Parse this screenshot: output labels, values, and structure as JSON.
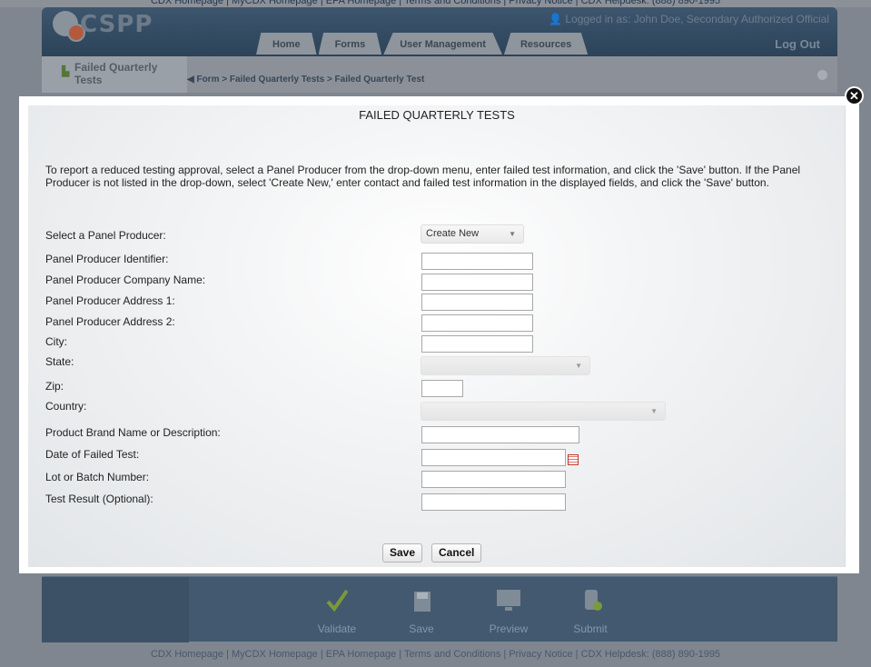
{
  "top_links": "CDX Homepage  |  MyCDX Homepage  |  EPA Homepage  |  Terms and Conditions  |  Privacy Notice  |  CDX Helpdesk: (888) 890-1995",
  "app": {
    "logo_text": "CSPP",
    "logged_in": "Logged in as: John Doe, Secondary Authorized Official",
    "logout": "Log Out",
    "tabs": [
      "Home",
      "Forms",
      "User Management",
      "Resources"
    ],
    "sub_title": "Failed Quarterly Tests",
    "breadcrumb": "Form > Failed Quarterly Tests > Failed Quarterly Test"
  },
  "modal": {
    "title": "FAILED QUARTERLY TESTS",
    "instructions": "To report a reduced testing approval, select a Panel Producer from the drop-down menu, enter failed test information, and click the 'Save' button. If the Panel Producer is not listed in the drop-down, select 'Create New,' enter contact and failed test information in the displayed fields, and click the 'Save' button.",
    "fields": {
      "panel_producer_select": {
        "label": "Select a Panel Producer:",
        "value": "Create New"
      },
      "producer_id": {
        "label": "Panel Producer Identifier:",
        "value": ""
      },
      "company_name": {
        "label": "Panel Producer Company Name:",
        "value": ""
      },
      "address1": {
        "label": "Panel Producer Address 1:",
        "value": ""
      },
      "address2": {
        "label": "Panel Producer Address 2:",
        "value": ""
      },
      "city": {
        "label": "City:",
        "value": ""
      },
      "state": {
        "label": "State:",
        "value": ""
      },
      "zip": {
        "label": "Zip:",
        "value": ""
      },
      "country": {
        "label": "Country:",
        "value": ""
      },
      "brand": {
        "label": "Product Brand Name or Description:",
        "value": ""
      },
      "date_failed": {
        "label": "Date of Failed Test:",
        "value": ""
      },
      "lot": {
        "label": "Lot or Batch Number:",
        "value": ""
      },
      "test_result": {
        "label": "Test Result (Optional):",
        "value": ""
      }
    },
    "save_label": "Save",
    "cancel_label": "Cancel",
    "close_glyph": "✕"
  },
  "actions": [
    "Validate",
    "Save",
    "Preview",
    "Submit"
  ],
  "footer": "CDX Homepage  |  MyCDX Homepage  |  EPA Homepage  |  Terms and Conditions  |  Privacy Notice  |  CDX Helpdesk: (888) 890-1995"
}
